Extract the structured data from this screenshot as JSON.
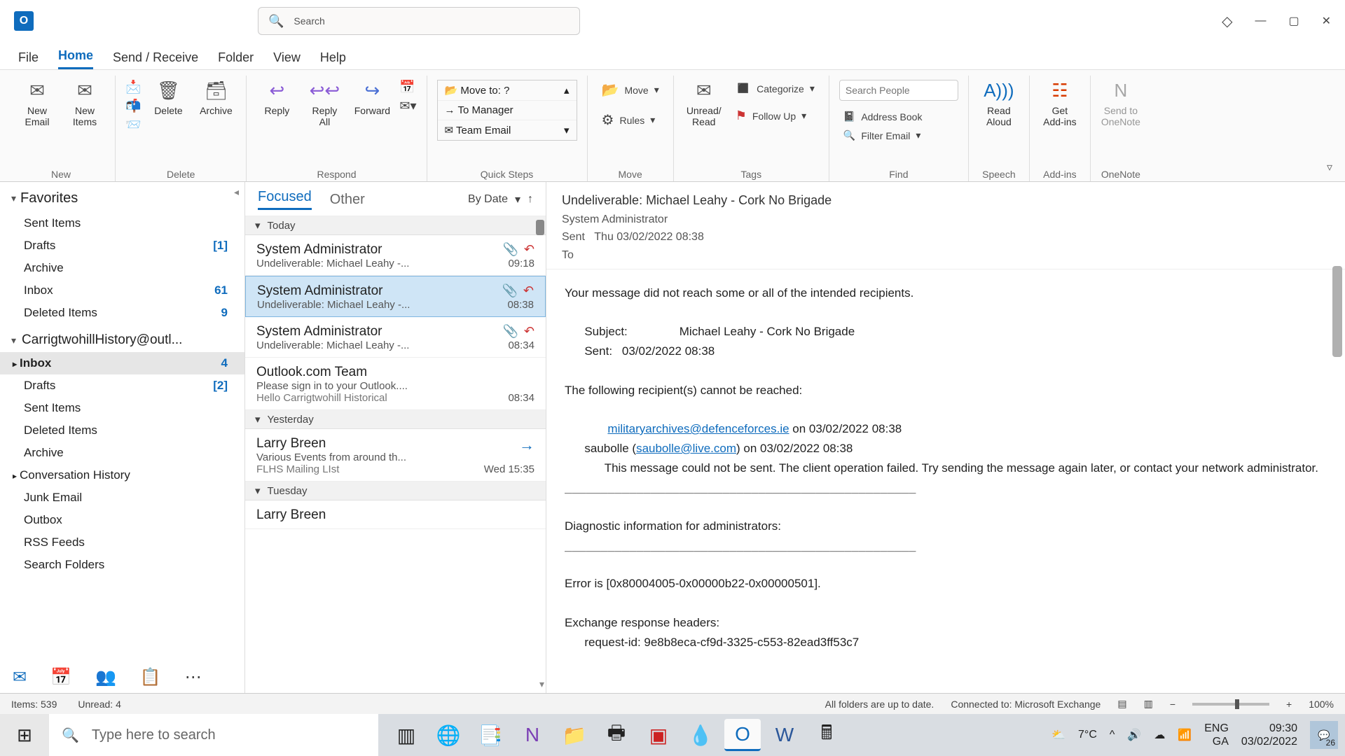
{
  "titlebar": {
    "search_placeholder": "Search"
  },
  "menu": [
    "File",
    "Home",
    "Send / Receive",
    "Folder",
    "View",
    "Help"
  ],
  "menu_active": 1,
  "ribbon": {
    "groups": {
      "new": {
        "label": "New",
        "new_email": "New\nEmail",
        "new_items": "New\nItems"
      },
      "delete": {
        "label": "Delete",
        "delete": "Delete",
        "archive": "Archive"
      },
      "respond": {
        "label": "Respond",
        "reply": "Reply",
        "reply_all": "Reply\nAll",
        "forward": "Forward"
      },
      "quick": {
        "label": "Quick Steps",
        "rows": [
          "Move to: ?",
          "To Manager",
          "Team Email"
        ]
      },
      "move": {
        "label": "Move",
        "move": "Move",
        "rules": "Rules"
      },
      "tags": {
        "label": "Tags",
        "unread": "Unread/\nRead",
        "categorize": "Categorize",
        "followup": "Follow Up"
      },
      "find": {
        "label": "Find",
        "search_people": "Search People",
        "address_book": "Address Book",
        "filter": "Filter Email"
      },
      "speech": {
        "label": "Speech",
        "read_aloud": "Read\nAloud"
      },
      "addins": {
        "label": "Add-ins",
        "get_addins": "Get\nAdd-ins"
      },
      "onenote": {
        "label": "OneNote",
        "send": "Send to\nOneNote"
      }
    }
  },
  "folders": {
    "favorites_label": "Favorites",
    "favorites": [
      {
        "name": "Sent Items"
      },
      {
        "name": "Drafts",
        "count": "[1]"
      },
      {
        "name": "Archive"
      },
      {
        "name": "Inbox",
        "count": "61"
      },
      {
        "name": "Deleted Items",
        "count": "9"
      }
    ],
    "account_label": "CarrigtwohillHistory@outl...",
    "account": [
      {
        "name": "Inbox",
        "count": "4",
        "sel": true,
        "exp": true
      },
      {
        "name": "Drafts",
        "count": "[2]"
      },
      {
        "name": "Sent Items"
      },
      {
        "name": "Deleted Items"
      },
      {
        "name": "Archive"
      },
      {
        "name": "Conversation History",
        "exp": true
      },
      {
        "name": "Junk Email"
      },
      {
        "name": "Outbox"
      },
      {
        "name": "RSS Feeds"
      },
      {
        "name": "Search Folders"
      }
    ]
  },
  "msglist": {
    "tab_focused": "Focused",
    "tab_other": "Other",
    "sort_label": "By Date",
    "groups": [
      {
        "label": "Today",
        "items": [
          {
            "from": "System Administrator",
            "subj": "Undeliverable: Michael Leahy -...",
            "time": "09:18",
            "ndr": true
          },
          {
            "from": "System Administrator",
            "subj": "Undeliverable: Michael Leahy -...",
            "time": "08:38",
            "ndr": true,
            "sel": true
          },
          {
            "from": "System Administrator",
            "subj": "Undeliverable: Michael Leahy -...",
            "time": "08:34",
            "ndr": true
          },
          {
            "from": "Outlook.com Team",
            "subj": "Please sign in to your Outlook....",
            "prev": "Hello Carrigtwohill Historical",
            "time": "08:34"
          }
        ]
      },
      {
        "label": "Yesterday",
        "items": [
          {
            "from": "Larry Breen",
            "subj": "Various Events from around th...",
            "prev": "FLHS Mailing LIst",
            "time": "Wed 15:35",
            "fwd": true
          }
        ]
      },
      {
        "label": "Tuesday",
        "items": [
          {
            "from": "Larry Breen",
            "subj": "",
            "time": ""
          }
        ]
      }
    ]
  },
  "reader": {
    "subject": "Undeliverable: Michael Leahy - Cork No Brigade",
    "from": "System Administrator",
    "sent_lbl": "Sent",
    "sent": "Thu 03/02/2022 08:38",
    "to_lbl": "To",
    "body_intro": "Your message did not reach some or all of the intended recipients.",
    "body_subject_line": "      Subject:\tMichael Leahy - Cork No Brigade",
    "body_sent_line": "      Sent:\t03/02/2022 08:38",
    "body_following": "The following recipient(s) cannot be reached:",
    "link1": "militaryarchives@defenceforces.ie",
    "link1_suffix": " on 03/02/2022 08:38",
    "line_saubolle_pre": "      saubolle (",
    "link2": "saubolle@live.com",
    "line_saubolle_post": ") on 03/02/2022 08:38",
    "fail_msg": "            This message could not be sent. The client operation failed. Try sending the message again later, or contact your network administrator.",
    "diag_hdr": "Diagnostic information for administrators:",
    "error_line": "Error is [0x80004005-0x00000b22-0x00000501].",
    "exch_hdr": "Exchange response headers:",
    "req_id": "      request-id: 9e8b8eca-cf9d-3325-c553-82ead3ff53c7"
  },
  "status": {
    "items": "Items: 539",
    "unread": "Unread: 4",
    "sync": "All folders are up to date.",
    "conn": "Connected to: Microsoft Exchange",
    "zoom": "100%"
  },
  "taskbar": {
    "search_placeholder": "Type here to search",
    "weather": "7°C",
    "lang1": "ENG",
    "lang2": "GA",
    "time": "09:30",
    "date": "03/02/2022",
    "notif_count": "26"
  }
}
